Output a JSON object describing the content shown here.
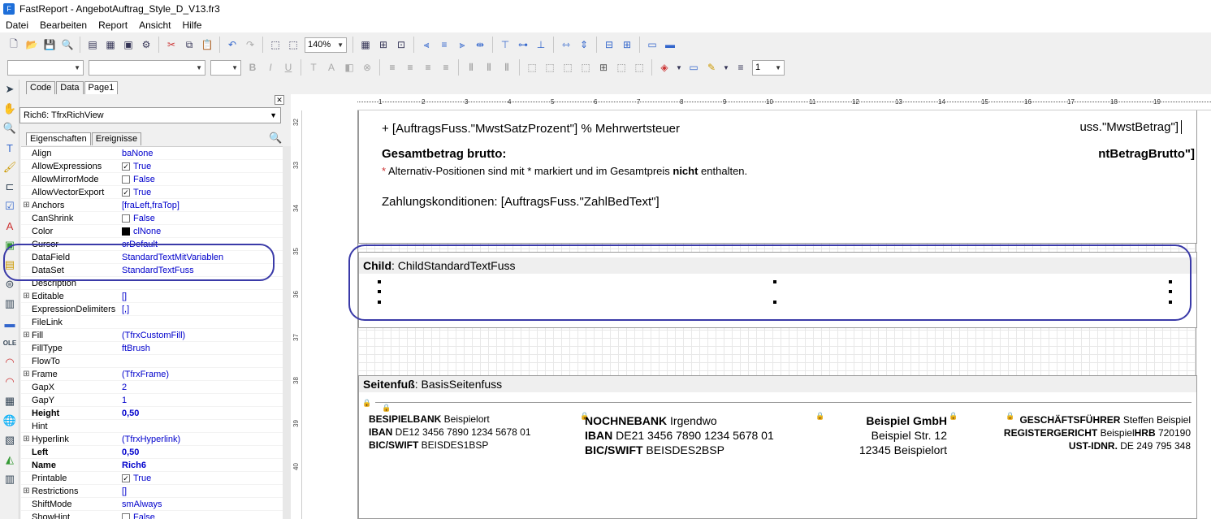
{
  "window": {
    "title": "FastReport - AngebotAuftrag_Style_D_V13.fr3"
  },
  "menu": [
    "Datei",
    "Bearbeiten",
    "Report",
    "Ansicht",
    "Hilfe"
  ],
  "toolbar": {
    "zoom": "140%",
    "line_width": "1"
  },
  "left_tabs": [
    "Code",
    "Data",
    "Page1"
  ],
  "object_selector": "Rich6: TfrxRichView",
  "prop_tabs": [
    "Eigenschaften",
    "Ereignisse"
  ],
  "properties": [
    {
      "name": "Align",
      "value": "baNone"
    },
    {
      "name": "AllowExpressions",
      "value": "True",
      "check": true
    },
    {
      "name": "AllowMirrorMode",
      "value": "False",
      "check": false
    },
    {
      "name": "AllowVectorExport",
      "value": "True",
      "check": true
    },
    {
      "name": "Anchors",
      "value": "[fraLeft,fraTop]",
      "exp": true
    },
    {
      "name": "CanShrink",
      "value": "False",
      "check": false
    },
    {
      "name": "Color",
      "value": "clNone",
      "swatch": true
    },
    {
      "name": "Cursor",
      "value": "crDefault"
    },
    {
      "name": "DataField",
      "value": "StandardTextMitVariablen"
    },
    {
      "name": "DataSet",
      "value": "StandardTextFuss"
    },
    {
      "name": "Description",
      "value": ""
    },
    {
      "name": "Editable",
      "value": "[]",
      "exp": true
    },
    {
      "name": "ExpressionDelimiters",
      "value": "[,]"
    },
    {
      "name": "FileLink",
      "value": ""
    },
    {
      "name": "Fill",
      "value": "(TfrxCustomFill)",
      "exp": true
    },
    {
      "name": "FillType",
      "value": "ftBrush"
    },
    {
      "name": "FlowTo",
      "value": ""
    },
    {
      "name": "Frame",
      "value": "(TfrxFrame)",
      "exp": true
    },
    {
      "name": "GapX",
      "value": "2"
    },
    {
      "name": "GapY",
      "value": "1"
    },
    {
      "name": "Height",
      "value": "0,50",
      "bold": true
    },
    {
      "name": "Hint",
      "value": ""
    },
    {
      "name": "Hyperlink",
      "value": "(TfrxHyperlink)",
      "exp": true
    },
    {
      "name": "Left",
      "value": "0,50",
      "bold": true
    },
    {
      "name": "Name",
      "value": "Rich6",
      "bold": true
    },
    {
      "name": "Printable",
      "value": "True",
      "check": true
    },
    {
      "name": "Restrictions",
      "value": "[]",
      "exp": true
    },
    {
      "name": "ShiftMode",
      "value": "smAlways"
    },
    {
      "name": "ShowHint",
      "value": "False",
      "check": false
    }
  ],
  "ruler": {
    "h": [
      "1",
      "2",
      "3",
      "4",
      "5",
      "6",
      "7",
      "8",
      "9",
      "10",
      "11",
      "12",
      "13",
      "14",
      "15",
      "16",
      "17",
      "18",
      "19"
    ],
    "v": [
      "32",
      "33",
      "34",
      "35",
      "36",
      "37",
      "38",
      "39",
      "40"
    ]
  },
  "report": {
    "line1": "+ [AuftragsFuss.\"MwstSatzProzent\"] % Mehrwertsteuer",
    "line1_right": "uss.\"MwstBetrag\"]",
    "gesamt": "Gesamtbetrag brutto:",
    "gesamt_right": "ntBetragBrutto\"]",
    "alt_pre": "Alternativ-Positionen sind mit * markiert und im Gesamtpreis ",
    "alt_bold": "nicht",
    "alt_post": " enthalten.",
    "zahlung": "Zahlungskonditionen: [AuftragsFuss.\"ZahlBedText\"]",
    "child_label": "Child",
    "child_name": ": ChildStandardTextFuss",
    "footer_label": "Seitenfuß",
    "footer_name": ": BasisSeitenfuss"
  },
  "footer": {
    "bank1": {
      "name": "BESIPIELBANK",
      "city": " Beispielort",
      "iban_l": "IBAN",
      "iban": " DE12 3456 7890 1234 5678 01",
      "bic_l": "BIC/SWIFT",
      "bic": " BEISDES1BSP"
    },
    "bank2": {
      "name": "NOCHNEBANK",
      "city": " Irgendwo",
      "iban_l": "IBAN",
      "iban": " DE21 3456 7890 1234 5678 01",
      "bic_l": "BIC/SWIFT",
      "bic": " BEISDES2BSP"
    },
    "company": {
      "name": "Beispiel GmbH",
      "street": "Beispiel Str. 12",
      "city": "12345 Beispielort"
    },
    "legal": {
      "gf_l": "GESCHÄFTSFÜHRER",
      "gf": " Steffen Beispiel",
      "rg_l": "REGISTERGERICHT",
      "rg": " Beispiel",
      "hrb_l": "HRB",
      "hrb": " 720190",
      "ust_l": "UST-IDNR.",
      "ust": " DE 249 795 348"
    }
  },
  "colors": {
    "annotation": "#3a3aa8",
    "value_text": "#0000cc"
  }
}
